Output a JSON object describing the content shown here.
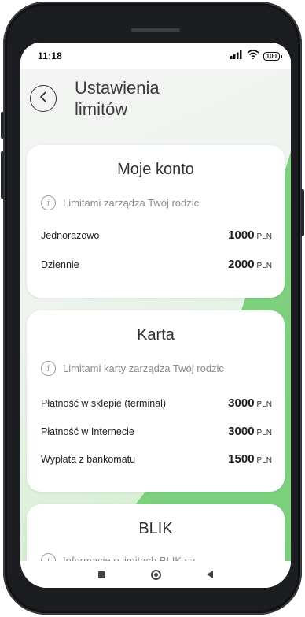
{
  "status_bar": {
    "time": "11:18",
    "battery": "100",
    "icons": [
      "signal-icon",
      "wifi-icon",
      "battery-icon"
    ]
  },
  "header": {
    "back_icon": "chevron-left-icon",
    "title_line1": "Ustawienia",
    "title_line2": "limitów"
  },
  "cards": {
    "account": {
      "title": "Moje konto",
      "info": "Limitami zarządza Twój rodzic",
      "rows": [
        {
          "label": "Jednorazowo",
          "amount": "1000",
          "currency": "PLN"
        },
        {
          "label": "Dziennie",
          "amount": "2000",
          "currency": "PLN"
        }
      ]
    },
    "card": {
      "title": "Karta",
      "info": "Limitami karty zarządza Twój rodzic",
      "rows": [
        {
          "label": "Płatność w sklepie (terminal)",
          "amount": "3000",
          "currency": "PLN"
        },
        {
          "label": "Płatność w Internecie",
          "amount": "3000",
          "currency": "PLN"
        },
        {
          "label": "Wypłata z bankomatu",
          "amount": "1500",
          "currency": "PLN"
        }
      ]
    },
    "blik": {
      "title": "BLIK",
      "info": "Informacje o limitach BLIK są"
    }
  },
  "nav_bar": {
    "icons": [
      "recent-apps-icon",
      "home-icon",
      "back-icon"
    ]
  },
  "colors": {
    "accent_green": "#72cc73",
    "phone_frame": "#1c1d20"
  }
}
